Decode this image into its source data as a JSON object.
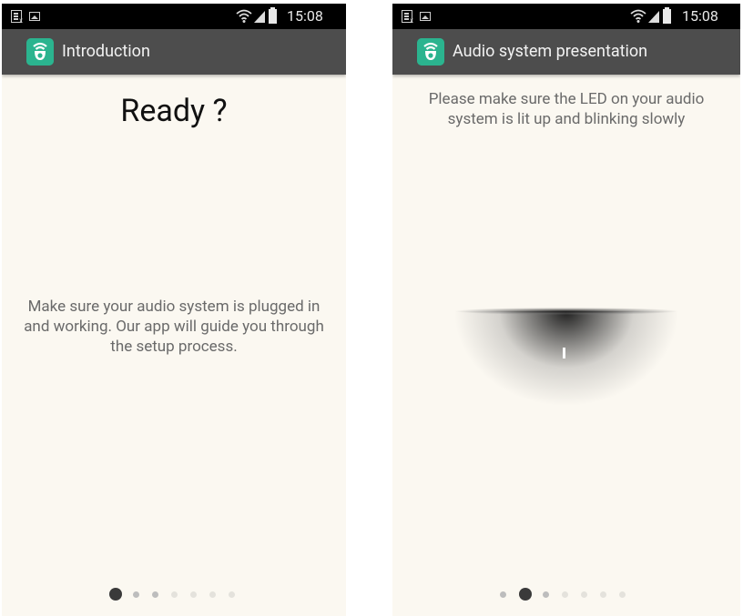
{
  "screens": [
    {
      "status_bar": {
        "time": "15:08",
        "icons": [
          "screenshot-notification-icon",
          "image-notification-icon",
          "wifi-icon",
          "signal-icon",
          "battery-icon"
        ]
      },
      "action_bar": {
        "title": "Introduction",
        "app_icon": "app-logo-icon",
        "app_icon_color": "#2bb48f"
      },
      "headline": "Ready ?",
      "body": "Make sure your audio system is plugged in and working. Our app will guide you through the setup process.",
      "pager": {
        "total": 7,
        "current": 1
      }
    },
    {
      "status_bar": {
        "time": "15:08",
        "icons": [
          "screenshot-notification-icon",
          "image-notification-icon",
          "wifi-icon",
          "signal-icon",
          "battery-icon"
        ]
      },
      "action_bar": {
        "title": "Audio system presentation",
        "app_icon": "app-logo-icon",
        "app_icon_color": "#2bb48f"
      },
      "body": "Please make sure the LED on your audio system is lit up and blinking slowly",
      "illustration": "audio-device-led-icon",
      "pager": {
        "total": 7,
        "current": 2
      }
    }
  ]
}
